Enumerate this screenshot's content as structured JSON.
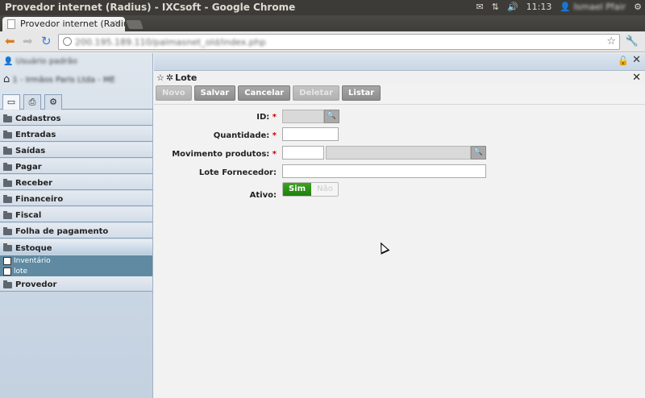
{
  "os": {
    "window_title": "Provedor internet (Radius) - IXCsoft - Google Chrome",
    "time": "11:13",
    "user": "Ismael Pfair"
  },
  "browser": {
    "tab_title": "Provedor internet (Radius)",
    "tab_close": "×",
    "url": "200.195.189.110/palmasnet_old/index.php"
  },
  "sidebar": {
    "user": "Usuário padrão",
    "company": "1 - Irmãos Paris Ltda - ME",
    "menu": [
      {
        "label": "Cadastros"
      },
      {
        "label": "Entradas"
      },
      {
        "label": "Saídas"
      },
      {
        "label": "Pagar"
      },
      {
        "label": "Receber"
      },
      {
        "label": "Financeiro"
      },
      {
        "label": "Fiscal"
      },
      {
        "label": "Folha de pagamento"
      }
    ],
    "open_menu": {
      "label": "Estoque",
      "items": [
        {
          "label": "Inventário"
        },
        {
          "label": "lote"
        }
      ]
    },
    "after_menu": [
      {
        "label": "Provedor"
      }
    ]
  },
  "panel": {
    "title": "Lote",
    "buttons": {
      "novo": "Novo",
      "salvar": "Salvar",
      "cancelar": "Cancelar",
      "deletar": "Deletar",
      "listar": "Listar"
    },
    "form": {
      "id_label": "ID:",
      "quantidade_label": "Quantidade:",
      "movimento_label": "Movimento produtos:",
      "lote_fornecedor_label": "Lote Fornecedor:",
      "ativo_label": "Ativo:",
      "required_mark": "*",
      "ativo_on": "Sim",
      "ativo_off": "Não"
    }
  }
}
